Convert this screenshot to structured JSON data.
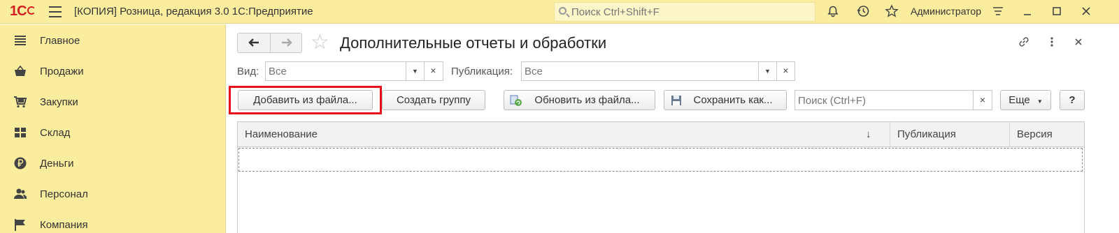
{
  "topbar": {
    "logo": "1С",
    "title": "[КОПИЯ] Розница, редакция 3.0 1С:Предприятие",
    "search_placeholder": "Поиск Ctrl+Shift+F",
    "username": "Администратор"
  },
  "sidebar": {
    "items": [
      {
        "label": "Главное",
        "icon": "list-icon"
      },
      {
        "label": "Продажи",
        "icon": "basket-icon"
      },
      {
        "label": "Закупки",
        "icon": "cart-icon"
      },
      {
        "label": "Склад",
        "icon": "warehouse-icon"
      },
      {
        "label": "Деньги",
        "icon": "ruble-icon"
      },
      {
        "label": "Персонал",
        "icon": "people-icon"
      },
      {
        "label": "Компания",
        "icon": "flag-icon"
      }
    ]
  },
  "form": {
    "title": "Дополнительные отчеты и обработки",
    "filters": {
      "vid_label": "Вид:",
      "vid_value": "Все",
      "publication_label": "Публикация:",
      "publication_value": "Все"
    },
    "toolbar": {
      "add_from_file": "Добавить из файла...",
      "create_group": "Создать группу",
      "update_from_file": "Обновить из файла...",
      "save_as": "Сохранить как...",
      "search_placeholder": "Поиск (Ctrl+F)",
      "more": "Еще",
      "help": "?"
    },
    "table": {
      "columns": [
        "Наименование",
        "Публикация",
        "Версия"
      ],
      "sort_indicator": "↓",
      "rows": []
    }
  },
  "colors": {
    "panel_bg": "#fbed9e",
    "highlight": "#e8101c"
  }
}
